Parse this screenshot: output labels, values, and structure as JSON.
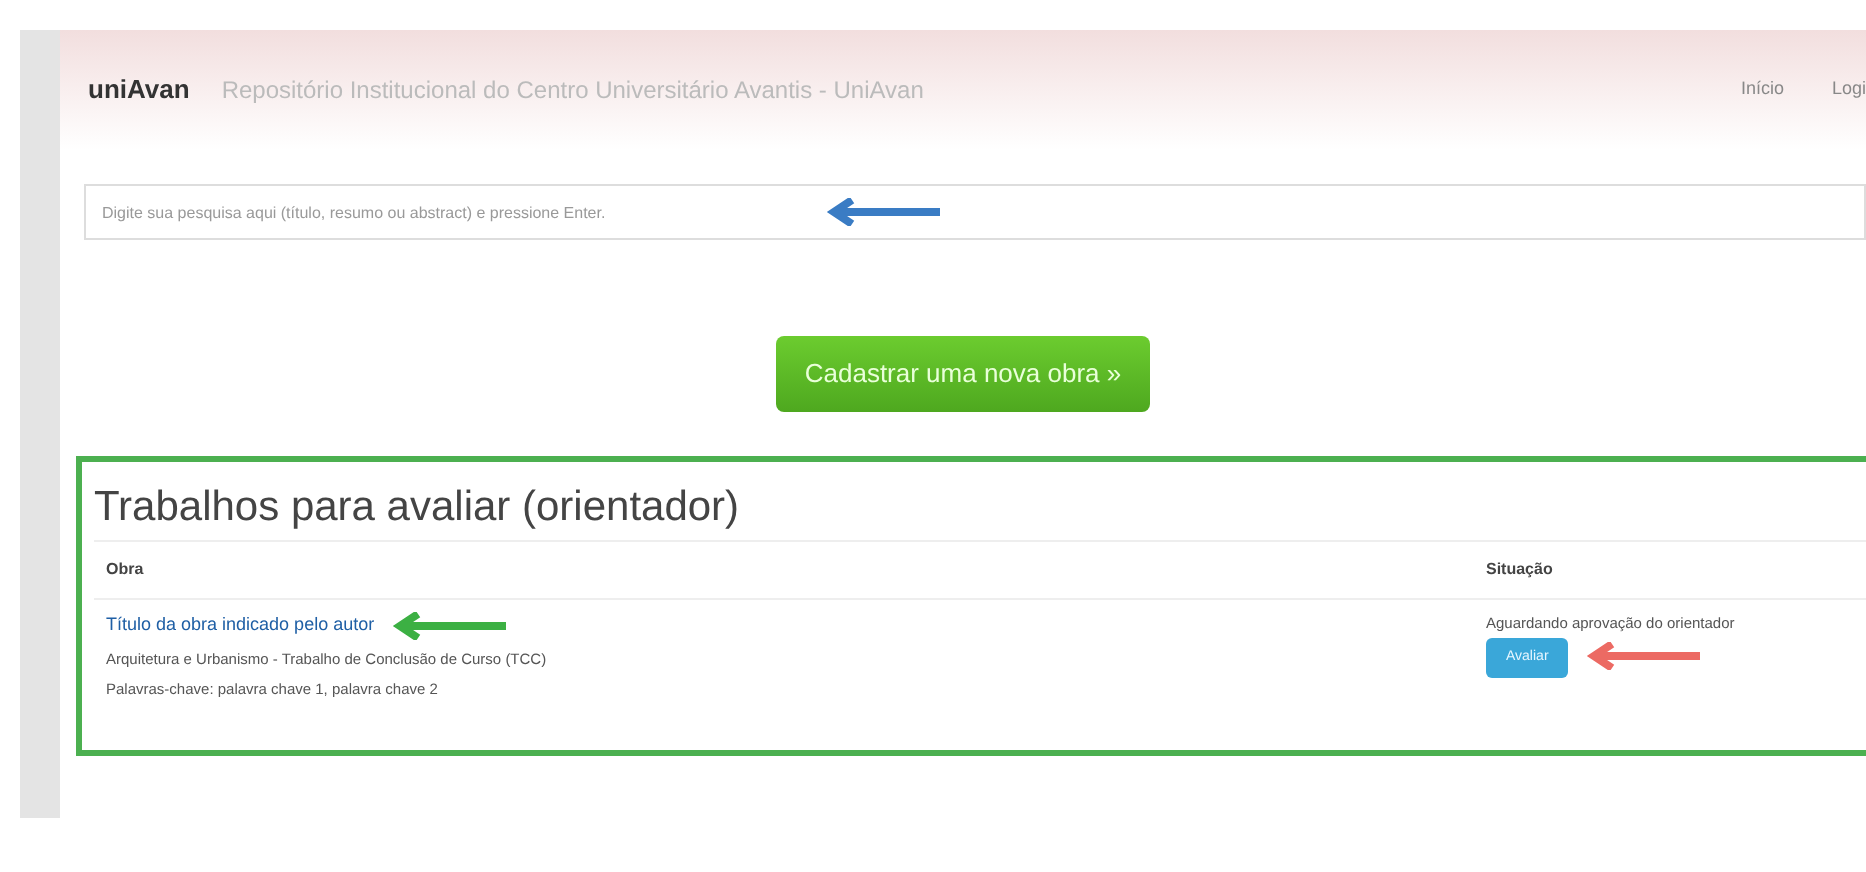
{
  "header": {
    "logo": "uniAvan",
    "title": "Repositório Institucional do Centro Universitário Avantis - UniAvan",
    "nav": [
      "Início",
      "Logi"
    ]
  },
  "search": {
    "placeholder": "Digite sua pesquisa aqui (título, resumo ou abstract) e pressione Enter.",
    "arrow": {
      "color": "#3a7cc4"
    }
  },
  "new_button": "Cadastrar uma nova obra »",
  "section": {
    "title": "Trabalhos para avaliar (orientador)",
    "columns": [
      "Obra",
      "Situação"
    ],
    "rows": [
      {
        "title": "Título da obra indicado pelo autor",
        "course": "Arquitetura e Urbanismo - Trabalho de Conclusão de Curso (TCC)",
        "keywords": "Palavras-chave: palavra chave 1, palavra chave 2",
        "status": "Aguardando aprovação do orientador",
        "action": "Avaliar",
        "title_arrow": {
          "color": "#3cb043"
        },
        "action_arrow": {
          "color": "#ec6a63"
        }
      }
    ]
  }
}
